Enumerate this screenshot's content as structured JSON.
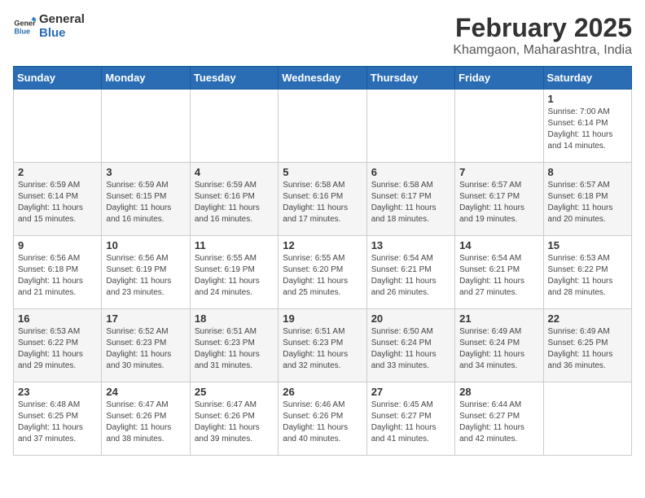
{
  "header": {
    "logo_general": "General",
    "logo_blue": "Blue",
    "title": "February 2025",
    "subtitle": "Khamgaon, Maharashtra, India"
  },
  "columns": [
    "Sunday",
    "Monday",
    "Tuesday",
    "Wednesday",
    "Thursday",
    "Friday",
    "Saturday"
  ],
  "weeks": [
    [
      {
        "day": "",
        "sunrise": "",
        "sunset": "",
        "daylight": ""
      },
      {
        "day": "",
        "sunrise": "",
        "sunset": "",
        "daylight": ""
      },
      {
        "day": "",
        "sunrise": "",
        "sunset": "",
        "daylight": ""
      },
      {
        "day": "",
        "sunrise": "",
        "sunset": "",
        "daylight": ""
      },
      {
        "day": "",
        "sunrise": "",
        "sunset": "",
        "daylight": ""
      },
      {
        "day": "",
        "sunrise": "",
        "sunset": "",
        "daylight": ""
      },
      {
        "day": "1",
        "sunrise": "Sunrise: 7:00 AM",
        "sunset": "Sunset: 6:14 PM",
        "daylight": "Daylight: 11 hours and 14 minutes."
      }
    ],
    [
      {
        "day": "2",
        "sunrise": "Sunrise: 6:59 AM",
        "sunset": "Sunset: 6:14 PM",
        "daylight": "Daylight: 11 hours and 15 minutes."
      },
      {
        "day": "3",
        "sunrise": "Sunrise: 6:59 AM",
        "sunset": "Sunset: 6:15 PM",
        "daylight": "Daylight: 11 hours and 16 minutes."
      },
      {
        "day": "4",
        "sunrise": "Sunrise: 6:59 AM",
        "sunset": "Sunset: 6:16 PM",
        "daylight": "Daylight: 11 hours and 16 minutes."
      },
      {
        "day": "5",
        "sunrise": "Sunrise: 6:58 AM",
        "sunset": "Sunset: 6:16 PM",
        "daylight": "Daylight: 11 hours and 17 minutes."
      },
      {
        "day": "6",
        "sunrise": "Sunrise: 6:58 AM",
        "sunset": "Sunset: 6:17 PM",
        "daylight": "Daylight: 11 hours and 18 minutes."
      },
      {
        "day": "7",
        "sunrise": "Sunrise: 6:57 AM",
        "sunset": "Sunset: 6:17 PM",
        "daylight": "Daylight: 11 hours and 19 minutes."
      },
      {
        "day": "8",
        "sunrise": "Sunrise: 6:57 AM",
        "sunset": "Sunset: 6:18 PM",
        "daylight": "Daylight: 11 hours and 20 minutes."
      }
    ],
    [
      {
        "day": "9",
        "sunrise": "Sunrise: 6:56 AM",
        "sunset": "Sunset: 6:18 PM",
        "daylight": "Daylight: 11 hours and 21 minutes."
      },
      {
        "day": "10",
        "sunrise": "Sunrise: 6:56 AM",
        "sunset": "Sunset: 6:19 PM",
        "daylight": "Daylight: 11 hours and 23 minutes."
      },
      {
        "day": "11",
        "sunrise": "Sunrise: 6:55 AM",
        "sunset": "Sunset: 6:19 PM",
        "daylight": "Daylight: 11 hours and 24 minutes."
      },
      {
        "day": "12",
        "sunrise": "Sunrise: 6:55 AM",
        "sunset": "Sunset: 6:20 PM",
        "daylight": "Daylight: 11 hours and 25 minutes."
      },
      {
        "day": "13",
        "sunrise": "Sunrise: 6:54 AM",
        "sunset": "Sunset: 6:21 PM",
        "daylight": "Daylight: 11 hours and 26 minutes."
      },
      {
        "day": "14",
        "sunrise": "Sunrise: 6:54 AM",
        "sunset": "Sunset: 6:21 PM",
        "daylight": "Daylight: 11 hours and 27 minutes."
      },
      {
        "day": "15",
        "sunrise": "Sunrise: 6:53 AM",
        "sunset": "Sunset: 6:22 PM",
        "daylight": "Daylight: 11 hours and 28 minutes."
      }
    ],
    [
      {
        "day": "16",
        "sunrise": "Sunrise: 6:53 AM",
        "sunset": "Sunset: 6:22 PM",
        "daylight": "Daylight: 11 hours and 29 minutes."
      },
      {
        "day": "17",
        "sunrise": "Sunrise: 6:52 AM",
        "sunset": "Sunset: 6:23 PM",
        "daylight": "Daylight: 11 hours and 30 minutes."
      },
      {
        "day": "18",
        "sunrise": "Sunrise: 6:51 AM",
        "sunset": "Sunset: 6:23 PM",
        "daylight": "Daylight: 11 hours and 31 minutes."
      },
      {
        "day": "19",
        "sunrise": "Sunrise: 6:51 AM",
        "sunset": "Sunset: 6:23 PM",
        "daylight": "Daylight: 11 hours and 32 minutes."
      },
      {
        "day": "20",
        "sunrise": "Sunrise: 6:50 AM",
        "sunset": "Sunset: 6:24 PM",
        "daylight": "Daylight: 11 hours and 33 minutes."
      },
      {
        "day": "21",
        "sunrise": "Sunrise: 6:49 AM",
        "sunset": "Sunset: 6:24 PM",
        "daylight": "Daylight: 11 hours and 34 minutes."
      },
      {
        "day": "22",
        "sunrise": "Sunrise: 6:49 AM",
        "sunset": "Sunset: 6:25 PM",
        "daylight": "Daylight: 11 hours and 36 minutes."
      }
    ],
    [
      {
        "day": "23",
        "sunrise": "Sunrise: 6:48 AM",
        "sunset": "Sunset: 6:25 PM",
        "daylight": "Daylight: 11 hours and 37 minutes."
      },
      {
        "day": "24",
        "sunrise": "Sunrise: 6:47 AM",
        "sunset": "Sunset: 6:26 PM",
        "daylight": "Daylight: 11 hours and 38 minutes."
      },
      {
        "day": "25",
        "sunrise": "Sunrise: 6:47 AM",
        "sunset": "Sunset: 6:26 PM",
        "daylight": "Daylight: 11 hours and 39 minutes."
      },
      {
        "day": "26",
        "sunrise": "Sunrise: 6:46 AM",
        "sunset": "Sunset: 6:26 PM",
        "daylight": "Daylight: 11 hours and 40 minutes."
      },
      {
        "day": "27",
        "sunrise": "Sunrise: 6:45 AM",
        "sunset": "Sunset: 6:27 PM",
        "daylight": "Daylight: 11 hours and 41 minutes."
      },
      {
        "day": "28",
        "sunrise": "Sunrise: 6:44 AM",
        "sunset": "Sunset: 6:27 PM",
        "daylight": "Daylight: 11 hours and 42 minutes."
      },
      {
        "day": "",
        "sunrise": "",
        "sunset": "",
        "daylight": ""
      }
    ]
  ]
}
